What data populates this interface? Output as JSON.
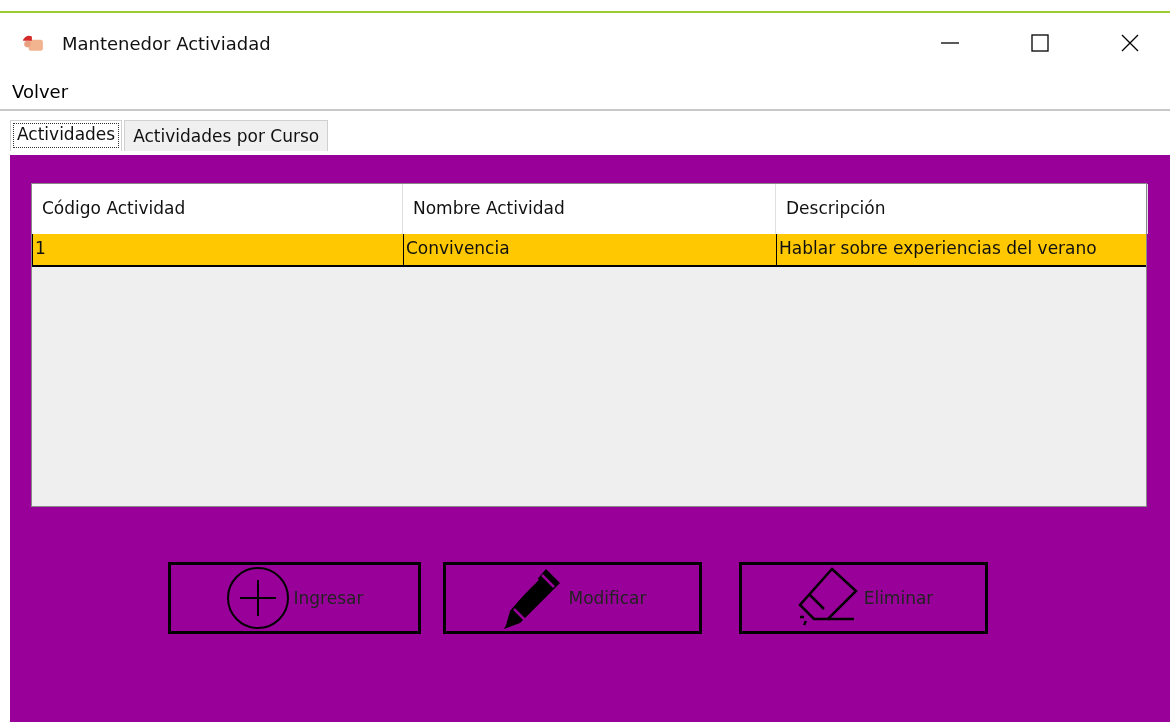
{
  "window": {
    "title": "Mantenedor Activiadad"
  },
  "menu": [
    "Volver"
  ],
  "tabs": [
    {
      "label": "Actividades",
      "selected": true
    },
    {
      "label": "Actividades por Curso",
      "selected": false
    }
  ],
  "table": {
    "columns": [
      "Código Actividad",
      "Nombre Actividad",
      "Descripción"
    ],
    "rows": [
      {
        "cells": [
          "1",
          "Convivencia",
          "Hablar sobre experiencias del verano"
        ],
        "selected": true
      }
    ]
  },
  "buttons": [
    {
      "kind": "add",
      "label": "Ingresar"
    },
    {
      "kind": "edit",
      "label": "Modificar"
    },
    {
      "kind": "delete",
      "label": "Eliminar"
    }
  ]
}
